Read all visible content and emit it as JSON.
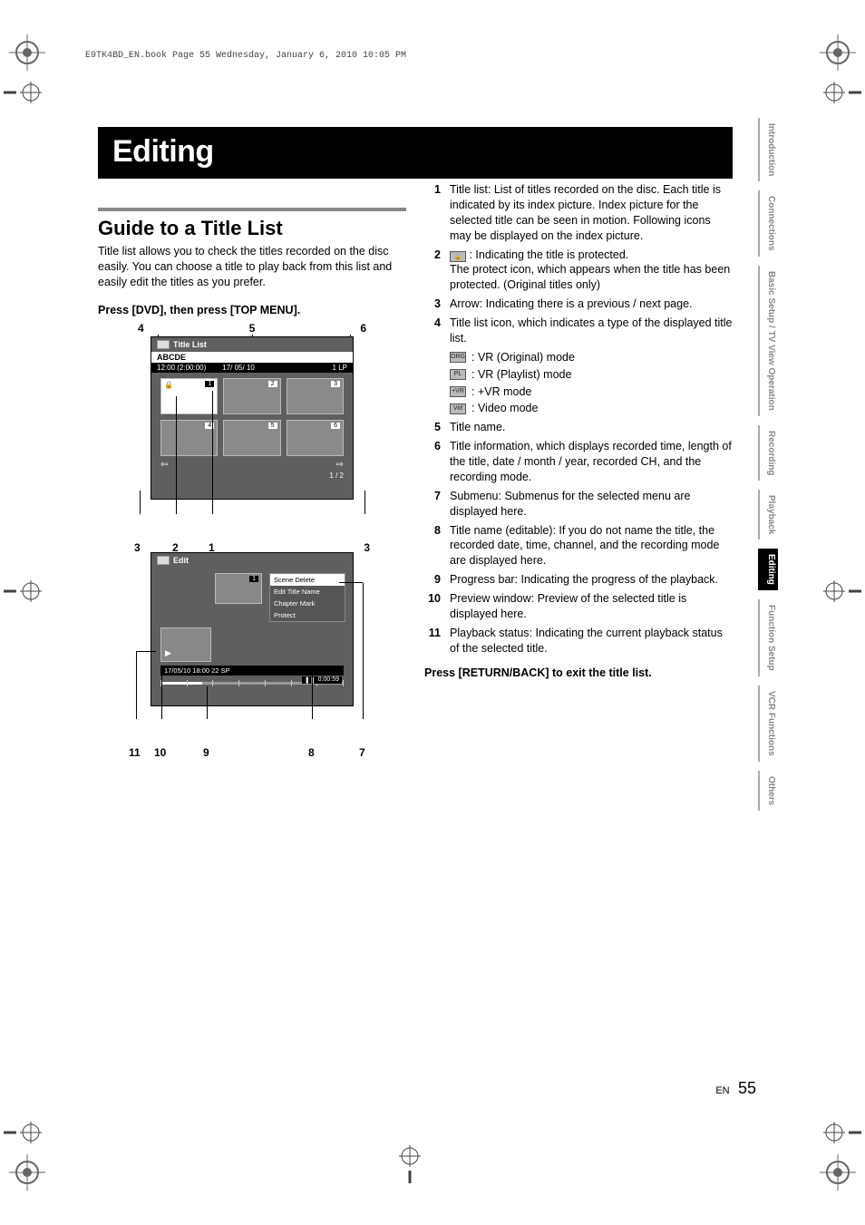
{
  "meta": {
    "header_line": "E9TK4BD_EN.book  Page 55  Wednesday, January 6, 2010  10:05 PM"
  },
  "banner": {
    "title": "Editing"
  },
  "section": {
    "title": "Guide to a Title List",
    "intro": "Title list allows you to check the titles recorded on the disc easily. You can choose a title to play back from this list and easily edit the titles as you prefer.",
    "step1": "Press [DVD], then press [TOP MENU].",
    "return_instr": "Press [RETURN/BACK] to exit the title list."
  },
  "figure1": {
    "callouts_top": [
      "4",
      "5",
      "6"
    ],
    "callouts_bottom": {
      "l1": "3",
      "l2": "2",
      "l3": "1",
      "r": "3"
    },
    "titlebar_label": "Title List",
    "name": "ABCDE",
    "info_time": "12:00 (2:00:00)",
    "info_date": "17/ 05/ 10",
    "info_mode": "1 LP",
    "page": "1 / 2",
    "cells": [
      "1",
      "2",
      "3",
      "4",
      "5",
      "6"
    ]
  },
  "figure2": {
    "titlebar_label": "Edit",
    "thumb_num": "1",
    "menu_items": [
      "Scene Delete",
      "Edit Title Name",
      "Chapter Mark",
      "Protect"
    ],
    "info_line": "17/05/10 18:00  22  SP",
    "time": "0:00:59",
    "callouts_bottom": {
      "a": "11",
      "b": "10",
      "c": "9",
      "d": "8",
      "e": "7"
    }
  },
  "explanations": [
    {
      "n": "1",
      "t": "Title list: List of titles recorded on the disc. Each title is indicated by its index picture. Index picture for the selected title can be seen in motion. Following icons may be displayed on the index picture."
    },
    {
      "n": "2",
      "t_prefix": "",
      "t_icon": "lock",
      "t_after": " : Indicating the title is protected.",
      "t2": "The protect icon, which appears when the title has been protected. (Original titles only)"
    },
    {
      "n": "3",
      "t": "Arrow: Indicating there is a previous / next page."
    },
    {
      "n": "4",
      "t": "Title list icon, which indicates a type of the displayed title list.",
      "sub": [
        {
          "icon": "ORG",
          "label": ": VR (Original) mode"
        },
        {
          "icon": "PL",
          "label": ": VR (Playlist) mode"
        },
        {
          "icon": "+VR",
          "label": ": +VR mode"
        },
        {
          "icon": "Vid",
          "label": ": Video mode"
        }
      ]
    },
    {
      "n": "5",
      "t": "Title name."
    },
    {
      "n": "6",
      "t": "Title information, which displays recorded time, length of the title, date / month / year, recorded CH, and the recording mode."
    },
    {
      "n": "7",
      "t": "Submenu: Submenus for the selected menu are displayed here."
    },
    {
      "n": "8",
      "t": "Title name (editable): If you do not name the title, the recorded date, time, channel, and the recording mode are displayed here."
    },
    {
      "n": "9",
      "t": "Progress bar: Indicating the progress of the playback."
    },
    {
      "n": "10",
      "t": "Preview window: Preview of the selected title is displayed here."
    },
    {
      "n": "11",
      "t": "Playback status: Indicating the current playback status of the selected title."
    }
  ],
  "tabs": [
    "Introduction",
    "Connections",
    "Basic Setup / TV View Operation",
    "Recording",
    "Playback",
    "Editing",
    "Function Setup",
    "VCR Functions",
    "Others"
  ],
  "footer": {
    "lang": "EN",
    "page": "55"
  }
}
